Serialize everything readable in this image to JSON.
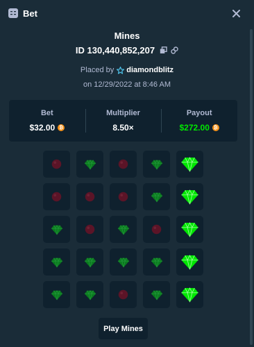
{
  "header": {
    "title": "Bet",
    "icon": "bet-slip-icon",
    "close_icon": "close-icon"
  },
  "game": {
    "title": "Mines",
    "bet_id": "ID 130,440,852,207",
    "placed_by_label": "Placed by",
    "username": "diamondblitz",
    "date": "on 12/29/2022 at 8:46 AM"
  },
  "stats": {
    "bet_label": "Bet",
    "bet_value": "$32.00",
    "multiplier_label": "Multiplier",
    "multiplier_value": "8.50×",
    "payout_label": "Payout",
    "payout_value": "$272.00"
  },
  "grid": {
    "rows": [
      [
        "mine",
        "gem",
        "mine",
        "gem",
        "gem-revealed"
      ],
      [
        "mine",
        "mine",
        "mine",
        "gem",
        "gem-revealed"
      ],
      [
        "gem",
        "mine",
        "gem",
        "mine",
        "gem-revealed"
      ],
      [
        "gem",
        "gem",
        "gem",
        "gem",
        "gem-revealed"
      ],
      [
        "gem",
        "gem",
        "mine",
        "gem",
        "gem-revealed"
      ]
    ]
  },
  "play_button_label": "Play Mines",
  "colors": {
    "background": "#1a2c38",
    "panel": "#0f212e",
    "muted_text": "#b1bad3",
    "payout_green": "#00e701",
    "coin": "#f7931a",
    "gem_dim": "#0b7a1f",
    "gem_bright": "#00e701",
    "mine": "#5b1427"
  }
}
